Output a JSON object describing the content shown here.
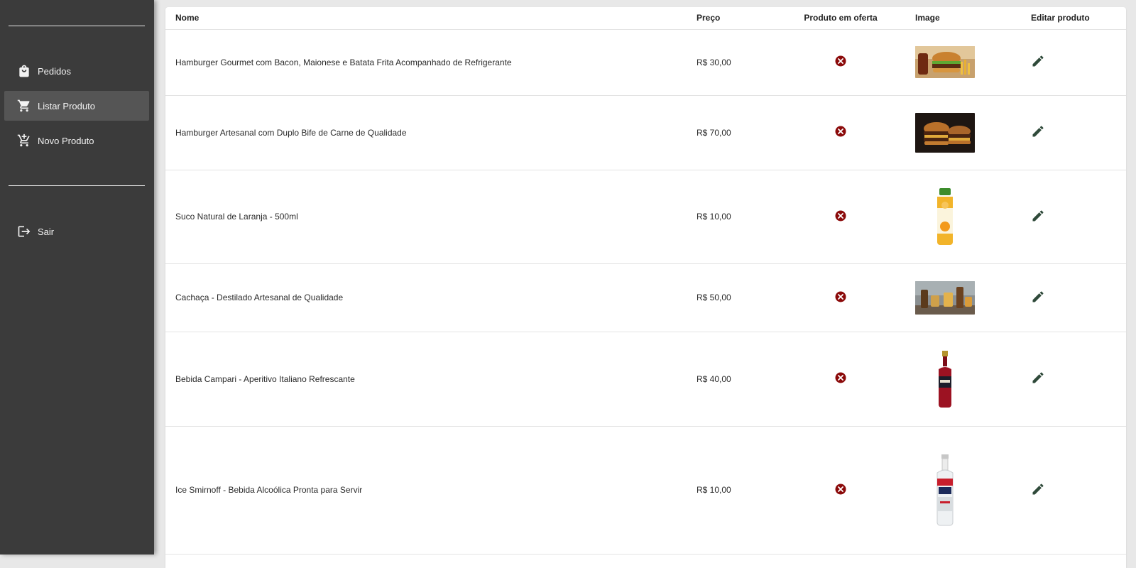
{
  "sidebar": {
    "items": [
      {
        "label": "Pedidos",
        "icon": "shopping-bag-icon"
      },
      {
        "label": "Listar Produto",
        "icon": "cart-icon",
        "active": true
      },
      {
        "label": "Novo Produto",
        "icon": "add-to-cart-icon"
      }
    ],
    "logout": {
      "label": "Sair",
      "icon": "logout-icon"
    }
  },
  "table": {
    "headers": {
      "name": "Nome",
      "price": "Preço",
      "offer": "Produto em oferta",
      "image": "Image",
      "edit": "Editar produto"
    },
    "rows": [
      {
        "name": "Hamburger Gourmet com Bacon, Maionese e Batata Frita Acompanhado de Refrigerante",
        "price": "R$ 30,00",
        "offer": false
      },
      {
        "name": "Hamburger Artesanal com Duplo Bife de Carne de Qualidade",
        "price": "R$ 70,00",
        "offer": false
      },
      {
        "name": "Suco Natural de Laranja - 500ml",
        "price": "R$ 10,00",
        "offer": false
      },
      {
        "name": "Cachaça - Destilado Artesanal de Qualidade",
        "price": "R$ 50,00",
        "offer": false
      },
      {
        "name": "Bebida Campari - Aperitivo Italiano Refrescante",
        "price": "R$ 40,00",
        "offer": false
      },
      {
        "name": "Ice Smirnoff - Bebida Alcoólica Pronta para Servir",
        "price": "R$ 10,00",
        "offer": false
      }
    ]
  },
  "colors": {
    "sidebar_bg": "#3b3b3b",
    "sidebar_active": "#555555",
    "offer_no": "#8b0a0a",
    "edit_icon": "#2f4a3a"
  }
}
